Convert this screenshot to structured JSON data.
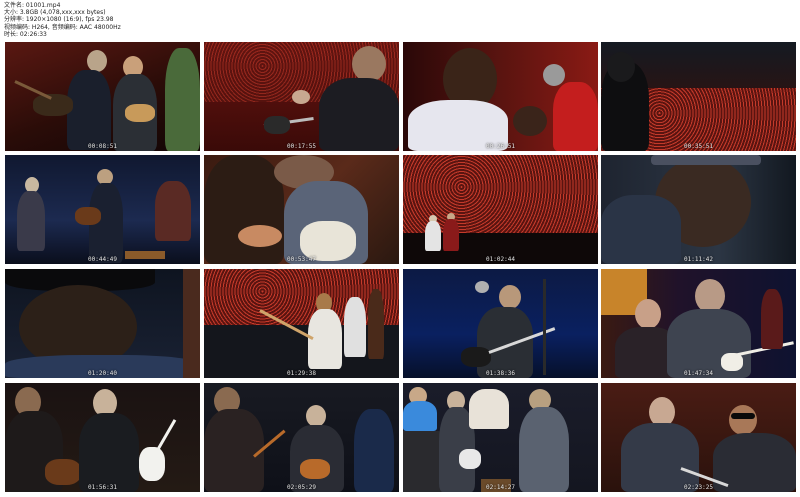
{
  "header": {
    "lines": [
      "文件名: 01001.mp4",
      "大小: 3.8GB (4,078,xxx,xxx bytes)",
      "分辨率: 1920×1080 (16:9), fps 23.98",
      "视频编码: H264, 音频编码: AAC 48000Hz",
      "时长: 02:26:33"
    ]
  },
  "thumbnails": [
    {
      "ts": "00:08:51"
    },
    {
      "ts": "00:17:55"
    },
    {
      "ts": "00:26:51"
    },
    {
      "ts": "00:35:51"
    },
    {
      "ts": "00:44:49"
    },
    {
      "ts": "00:53:47"
    },
    {
      "ts": "01:02:44"
    },
    {
      "ts": "01:11:42"
    },
    {
      "ts": "01:20:40"
    },
    {
      "ts": "01:29:38"
    },
    {
      "ts": "01:38:36"
    },
    {
      "ts": "01:47:34"
    },
    {
      "ts": "01:56:31"
    },
    {
      "ts": "02:05:29"
    },
    {
      "ts": "02:14:27"
    },
    {
      "ts": "02:23:25"
    }
  ],
  "colors": {
    "stage_red": "#7a1a14",
    "stage_blue": "#0c1a3a",
    "crowd_red": "#c53a2a",
    "guitar_sunburst": "#b86a2a",
    "guitar_white": "#f2f2ee"
  }
}
